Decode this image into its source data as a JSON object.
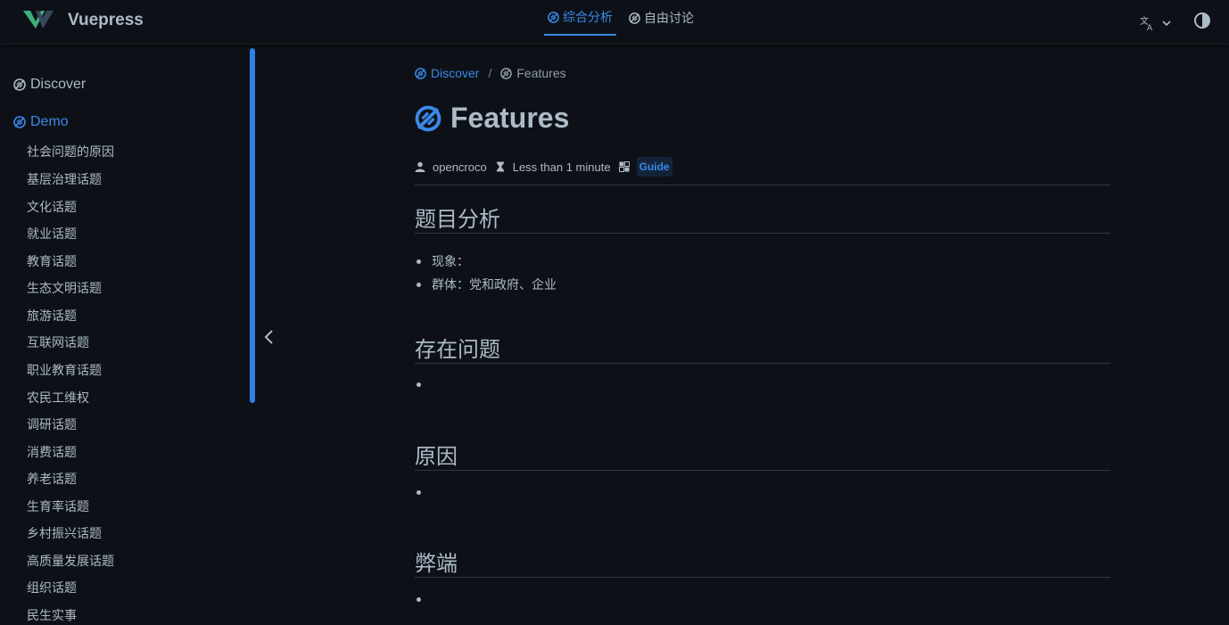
{
  "brand": {
    "name": "Vuepress"
  },
  "navbar": {
    "links": [
      {
        "label": "综合分析",
        "active": true
      },
      {
        "label": "自由讨论",
        "active": false
      }
    ]
  },
  "sidebar": {
    "groups": [
      {
        "label": "Discover",
        "active": false
      },
      {
        "label": "Demo",
        "active": true
      }
    ],
    "items": [
      "社会问题的原因",
      "基层治理话题",
      "文化话题",
      "就业话题",
      "教育话题",
      "生态文明话题",
      "旅游话题",
      "互联网话题",
      "职业教育话题",
      "农民工维权",
      "调研话题",
      "消费话题",
      "养老话题",
      "生育率话题",
      "乡村振兴话题",
      "高质量发展话题",
      "组织话题",
      "民生实事"
    ]
  },
  "breadcrumb": {
    "parent": "Discover",
    "separator": "/",
    "current": "Features"
  },
  "page": {
    "title": "Features",
    "meta": {
      "author": "opencroco",
      "reading_time": "Less than 1 minute",
      "category": "Guide"
    },
    "sections": [
      {
        "heading": "题目分析",
        "items": [
          "现象：",
          "群体：党和政府、企业"
        ]
      },
      {
        "heading": "存在问题",
        "items": [
          ""
        ]
      },
      {
        "heading": "原因",
        "items": [
          ""
        ]
      },
      {
        "heading": "弊端",
        "items": [
          ""
        ]
      }
    ]
  },
  "colors": {
    "accent": "#3a89ea",
    "background": "#0d1117",
    "text": "#adbac7"
  }
}
